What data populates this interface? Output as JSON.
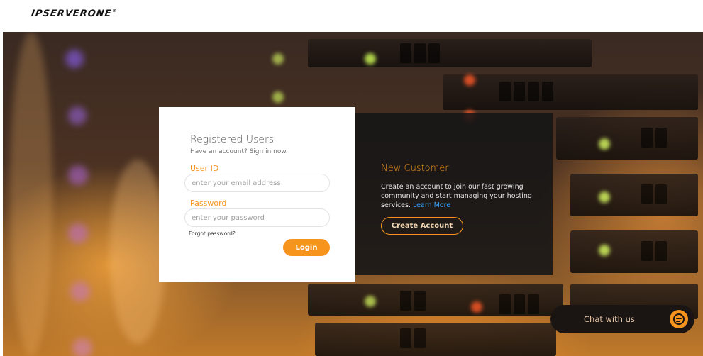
{
  "brand": {
    "logo_text": "IPSERVERONE"
  },
  "login": {
    "title": "Registered Users",
    "subtitle": "Have an account? Sign in now.",
    "user_id_label": "User ID",
    "user_id_placeholder": "enter your email address",
    "password_label": "Password",
    "password_placeholder": "enter your password",
    "forgot_link": "Forgot password?",
    "login_button": "Login"
  },
  "new_customer": {
    "title": "New Customer",
    "text": "Create an account to join our fast growing community and start managing your hosting services.",
    "learn_more": "Learn More",
    "create_button": "Create Account"
  },
  "chat": {
    "label": "Chat with us",
    "icon": "chat-bubble-icon"
  },
  "colors": {
    "accent": "#f7941d",
    "link": "#3aa0ff",
    "dark_panel": "#141416"
  }
}
